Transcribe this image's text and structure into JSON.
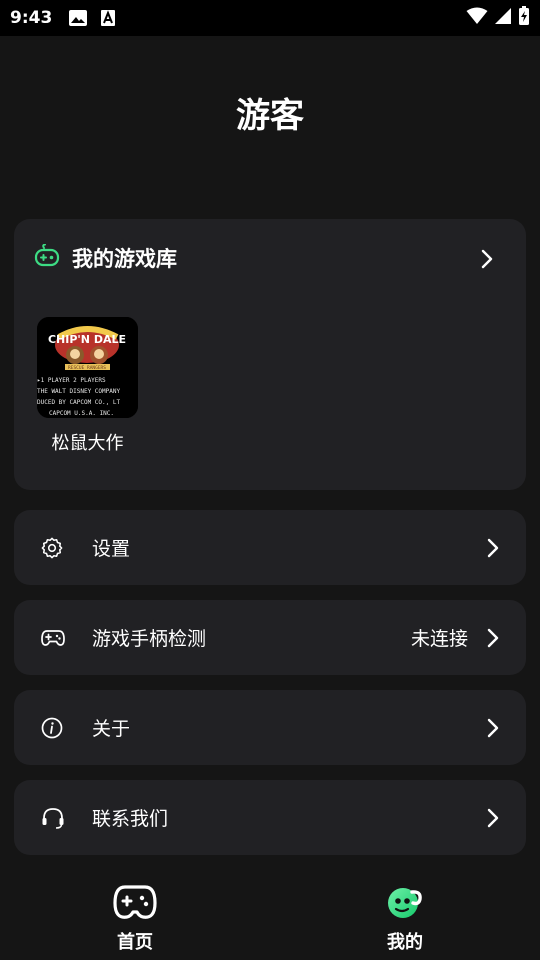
{
  "status_bar": {
    "time": "9:43"
  },
  "header": {
    "title": "游客"
  },
  "library": {
    "title": "我的游戏库",
    "games": [
      {
        "name": "松鼠大作",
        "cover_lines": [
          "▸1 PLAYER    2 PLAYERS",
          "THE WALT DISNEY COMPANY",
          "DUCED BY CAPCOM CO., LT",
          "CAPCOM U.S.A. INC."
        ]
      }
    ]
  },
  "menu": [
    {
      "label": "设置",
      "icon": "gear-icon",
      "value": ""
    },
    {
      "label": "游戏手柄检测",
      "icon": "gamepad-icon",
      "value": "未连接"
    },
    {
      "label": "关于",
      "icon": "info-icon",
      "value": ""
    },
    {
      "label": "联系我们",
      "icon": "headset-icon",
      "value": ""
    }
  ],
  "bottom_nav": {
    "home_label": "首页",
    "me_label": "我的"
  },
  "colors": {
    "background": "#151515",
    "card": "#212124",
    "accent_green": "#3ddc84"
  }
}
